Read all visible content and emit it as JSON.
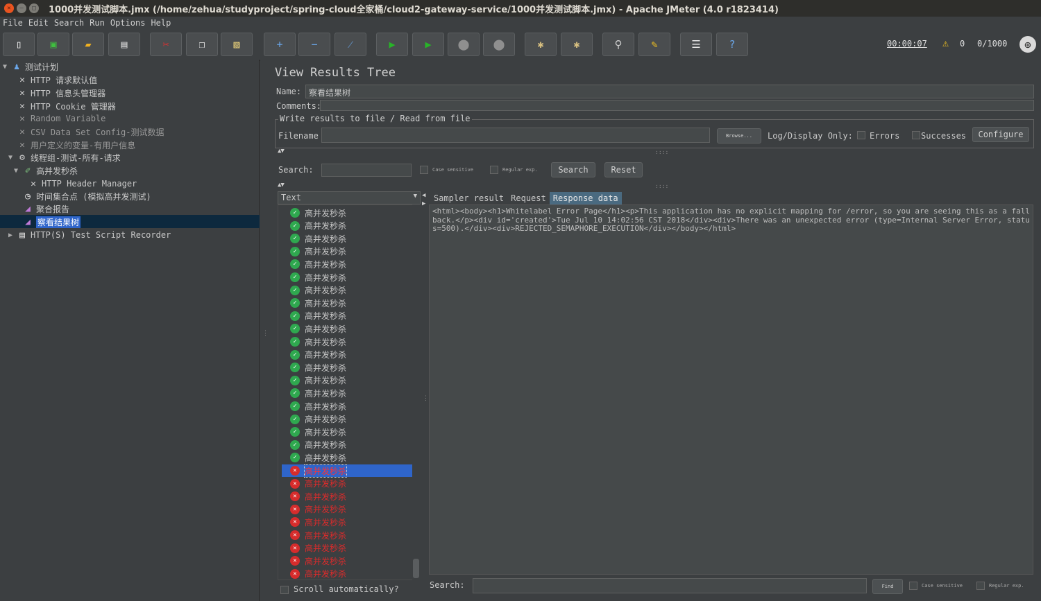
{
  "window": {
    "title": "1000并发测试脚本.jmx (/home/zehua/studyproject/spring-cloud全家桶/cloud2-gateway-service/1000并发测试脚本.jmx) - Apache JMeter (4.0 r1823414)"
  },
  "menu": [
    "File",
    "Edit",
    "Search",
    "Run",
    "Options",
    "Help"
  ],
  "toolbar": {
    "buttons": [
      {
        "name": "new-icon"
      },
      {
        "name": "templates-icon"
      },
      {
        "name": "open-icon"
      },
      {
        "name": "save-icon"
      },
      {
        "name": "cut-icon"
      },
      {
        "name": "copy-icon"
      },
      {
        "name": "paste-icon"
      },
      {
        "name": "expand-icon"
      },
      {
        "name": "collapse-icon"
      },
      {
        "name": "toggle-icon"
      },
      {
        "name": "start-icon"
      },
      {
        "name": "start-no-pause-icon"
      },
      {
        "name": "stop-icon"
      },
      {
        "name": "shutdown-icon"
      },
      {
        "name": "clear-icon"
      },
      {
        "name": "clear-all-icon"
      },
      {
        "name": "search-icon"
      },
      {
        "name": "reset-search-icon"
      },
      {
        "name": "function-helper-icon"
      },
      {
        "name": "help-icon"
      }
    ],
    "timer": "00:00:07",
    "warnings": "0",
    "threads": "0/1000"
  },
  "tree": {
    "nodes": [
      {
        "label": "测试计划",
        "icon": "test-plan-icon"
      },
      {
        "label": "HTTP 请求默认值",
        "icon": "config-wrench-icon"
      },
      {
        "label": "HTTP 信息头管理器",
        "icon": "config-wrench-icon"
      },
      {
        "label": "HTTP Cookie 管理器",
        "icon": "config-wrench-icon"
      },
      {
        "label": "Random Variable",
        "icon": "config-wrench-icon"
      },
      {
        "label": "CSV Data Set Config-测试数据",
        "icon": "config-wrench-icon"
      },
      {
        "label": "用户定义的变量-有用户信息",
        "icon": "config-wrench-icon"
      },
      {
        "label": "线程组-测试-所有-请求",
        "icon": "thread-group-icon"
      },
      {
        "label": "高并发秒杀",
        "icon": "sampler-icon"
      },
      {
        "label": "HTTP Header Manager",
        "icon": "config-wrench-icon"
      },
      {
        "label": "时间集合点 (模拟高并发测试)",
        "icon": "timer-icon"
      },
      {
        "label": "聚合报告",
        "icon": "listener-icon"
      },
      {
        "label": "察看结果树",
        "icon": "listener-icon"
      },
      {
        "label": "HTTP(S) Test Script Recorder",
        "icon": "recorder-icon"
      }
    ]
  },
  "panel": {
    "title": "View Results Tree",
    "name_label": "Name:",
    "name_value": "察看结果树",
    "comments_label": "Comments:",
    "comments_value": "",
    "file_group_title": "Write results to file / Read from file",
    "filename_label": "Filename",
    "filename_value": "",
    "browse_label": "Browse...",
    "log_display_label": "Log/Display Only:",
    "errors_label": "Errors",
    "successes_label": "Successes",
    "configure_label": "Configure",
    "search_label": "Search:",
    "search_value": "",
    "case_sensitive_label": "Case sensitive",
    "regular_exp_label": "Regular exp.",
    "search_button": "Search",
    "reset_button": "Reset"
  },
  "results": {
    "renderer": "Text",
    "items_ok_label": "高并发秒杀",
    "ok_count": 20,
    "err_count": 9,
    "items": [
      {
        "label": "高并发秒杀",
        "status": "ok"
      },
      {
        "label": "高并发秒杀",
        "status": "ok"
      },
      {
        "label": "高并发秒杀",
        "status": "ok"
      },
      {
        "label": "高并发秒杀",
        "status": "ok"
      },
      {
        "label": "高并发秒杀",
        "status": "ok"
      },
      {
        "label": "高并发秒杀",
        "status": "ok"
      },
      {
        "label": "高并发秒杀",
        "status": "ok"
      },
      {
        "label": "高并发秒杀",
        "status": "ok"
      },
      {
        "label": "高并发秒杀",
        "status": "ok"
      },
      {
        "label": "高并发秒杀",
        "status": "ok"
      },
      {
        "label": "高并发秒杀",
        "status": "ok"
      },
      {
        "label": "高并发秒杀",
        "status": "ok"
      },
      {
        "label": "高并发秒杀",
        "status": "ok"
      },
      {
        "label": "高并发秒杀",
        "status": "ok"
      },
      {
        "label": "高并发秒杀",
        "status": "ok"
      },
      {
        "label": "高并发秒杀",
        "status": "ok"
      },
      {
        "label": "高并发秒杀",
        "status": "ok"
      },
      {
        "label": "高并发秒杀",
        "status": "ok"
      },
      {
        "label": "高并发秒杀",
        "status": "ok"
      },
      {
        "label": "高并发秒杀",
        "status": "ok"
      },
      {
        "label": "高并发秒杀",
        "status": "err",
        "selected": true
      },
      {
        "label": "高并发秒杀",
        "status": "err"
      },
      {
        "label": "高并发秒杀",
        "status": "err"
      },
      {
        "label": "高并发秒杀",
        "status": "err"
      },
      {
        "label": "高并发秒杀",
        "status": "err"
      },
      {
        "label": "高并发秒杀",
        "status": "err"
      },
      {
        "label": "高并发秒杀",
        "status": "err"
      },
      {
        "label": "高并发秒杀",
        "status": "err"
      },
      {
        "label": "高并发秒杀",
        "status": "err"
      }
    ],
    "scroll_auto_label": "Scroll automatically?"
  },
  "response": {
    "tabs": [
      "Sampler result",
      "Request",
      "Response data"
    ],
    "active_tab": "Response data",
    "body": "<html><body><h1>Whitelabel Error Page</h1><p>This application has no explicit mapping for /error, so you are seeing this as a fallback.</p><div id='created'>Tue Jul 10 14:02:56 CST 2018</div><div>There was an unexpected error (type=Internal Server Error, status=500).</div><div>REJECTED_SEMAPHORE_EXECUTION</div></body></html>",
    "search_label": "Search:",
    "search_value": "",
    "find_label": "Find",
    "case_sensitive_label": "Case sensitive",
    "regular_exp_label": "Regular exp."
  }
}
